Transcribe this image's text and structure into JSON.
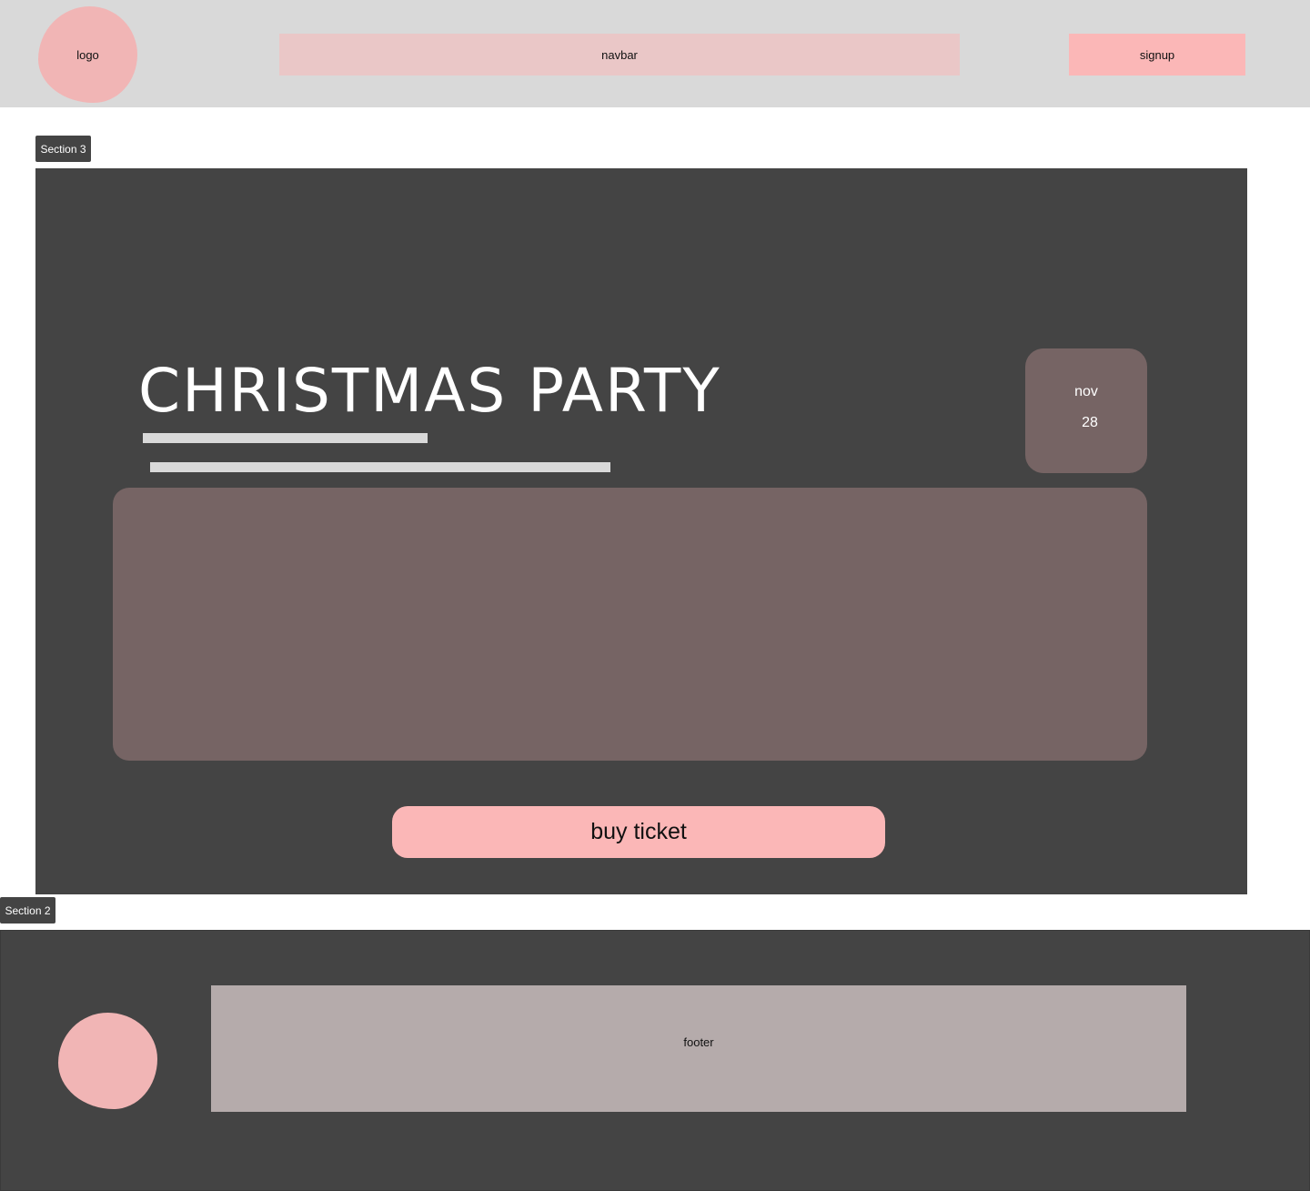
{
  "header": {
    "logo_label": "logo",
    "navbar_label": "navbar",
    "signup_label": "signup"
  },
  "sections": {
    "section3_label": "Section 3",
    "section2_label": "Section 2"
  },
  "event": {
    "title": "CHRISTMAS PARTY",
    "date_month": "nov",
    "date_day": "28",
    "cta_label": "buy ticket"
  },
  "footer": {
    "label": "footer"
  },
  "colors": {
    "header_bg": "#d9d9d9",
    "section_bg": "#444444",
    "accent_pink": "#fbb7b7",
    "logo_pink": "#f1b5b5",
    "card_brown": "#766464",
    "footer_gray": "#b5abab"
  }
}
